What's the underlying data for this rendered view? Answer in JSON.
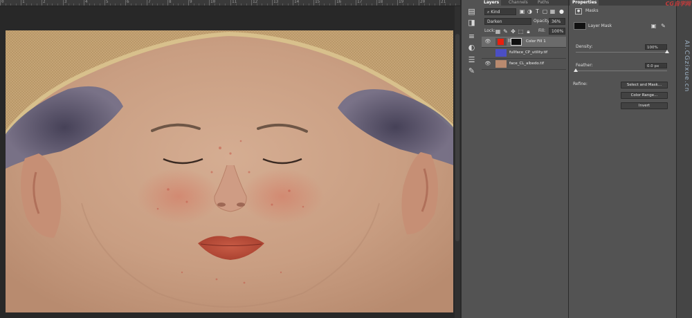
{
  "ruler": {
    "numbers": [
      "0",
      "1",
      "2",
      "3",
      "4",
      "5",
      "6",
      "7",
      "8",
      "9",
      "10",
      "11",
      "12",
      "13",
      "14",
      "15",
      "16",
      "17",
      "18",
      "19",
      "20",
      "21"
    ]
  },
  "toolstrip": {
    "icons": [
      "layers-icon",
      "channels-icon",
      "paths-icon",
      "adjustments-icon",
      "properties-icon",
      "brush-icon"
    ]
  },
  "layers_panel": {
    "tabs": [
      "Layers",
      "Channels",
      "Paths"
    ],
    "filter": {
      "label": "Kind"
    },
    "blend_mode": "Darken",
    "opacity_label": "Opacity:",
    "opacity_value": "36%",
    "lock_label": "Lock:",
    "fill_label": "Fill:",
    "fill_value": "100%",
    "layers": [
      {
        "name": "Color Fill 1",
        "visible": true,
        "selected": true
      },
      {
        "name": "fullface_CP_utility.tif",
        "visible": false,
        "selected": false
      },
      {
        "name": "face_CL_albedo.tif",
        "visible": true,
        "selected": false
      }
    ]
  },
  "properties_panel": {
    "tab": "Properties",
    "section": "Masks",
    "mask_label": "Layer Mask",
    "density_label": "Density:",
    "density_value": "100%",
    "density_fraction": 1.0,
    "feather_label": "Feather:",
    "feather_value": "0.0 px",
    "feather_fraction": 0.0,
    "refine_label": "Refine:",
    "buttons": [
      "Select and Mask...",
      "Color Range...",
      "Invert"
    ]
  },
  "watermark": {
    "top": "CG自学网",
    "side": "AI.CGzixue.cn"
  },
  "colors": {
    "fill_swatch": "#e8200e",
    "panel": "#535353",
    "dark": "#282828"
  }
}
